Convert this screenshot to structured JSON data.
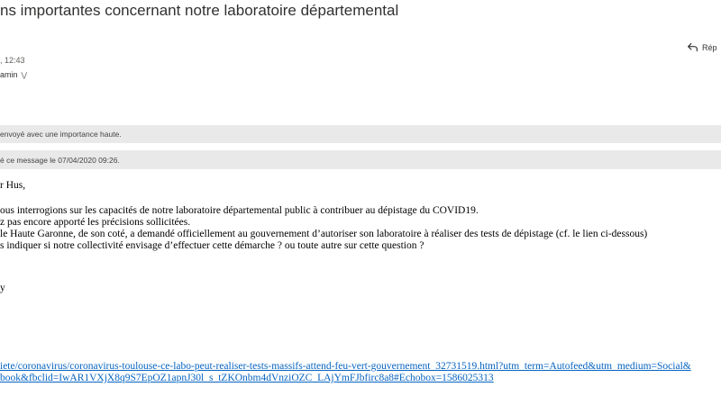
{
  "email": {
    "subject": "ns importantes concernant notre laboratoire départemental",
    "time": ", 12:43",
    "recipient": "amin",
    "reply_label": "Rép",
    "banner_importance": "envoyé avec une importance haute.",
    "banner_replied": "é ce message le 07/04/2020 09:26.",
    "body": {
      "greeting": "r Hus,",
      "line1": "ous interrogions sur les capacités de notre laboratoire départemental public à contribuer au dépistage du COVID19.",
      "line2": "z pas encore apporté les précisions sollicitées.",
      "line3": "le Haute Garonne, de son coté, a demandé officiellement au gouvernement d’autoriser son laboratoire à réaliser des tests de dépistage (cf. le lien ci-dessous)",
      "line4": "s indiquer si notre collectivité envisage d’effectuer cette démarche ? ou toute autre sur cette question ?",
      "signoff": "y"
    },
    "link": {
      "line1": "iete/coronavirus/coronavirus-toulouse-ce-labo-peut-realiser-tests-massifs-attend-feu-vert-gouvernement_32731519.html?utm_term=Autofeed&utm_medium=Social&",
      "line2": "book&fbclid=IwAR1VXjX8q9S7EpOZ1apnJ30l_s_tZKOnbm4dVnziOZC_LAjYmFJbfirc8a8#Echobox=1586025313"
    }
  },
  "icons": {
    "reply": "reply-arrow-icon",
    "expand": "chevron-down-icon"
  }
}
